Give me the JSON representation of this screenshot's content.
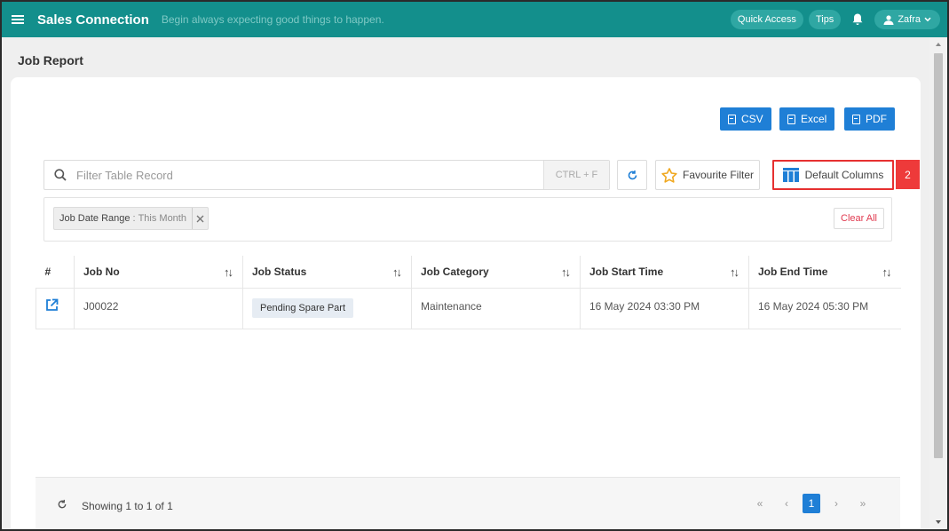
{
  "app": {
    "brand": "Sales Connection",
    "tagline": "Begin always expecting good things to happen.",
    "quick_access": "Quick Access",
    "tips": "Tips",
    "user": "Zafra"
  },
  "page": {
    "title": "Job Report"
  },
  "exports": {
    "csv": "CSV",
    "excel": "Excel",
    "pdf": "PDF"
  },
  "toolbar": {
    "search_placeholder": "Filter Table Record",
    "search_value": "",
    "shortcut": "CTRL + F",
    "favourite_filter": "Favourite Filter",
    "default_columns": "Default Columns",
    "step_badge": "2"
  },
  "filters": {
    "chip_key": "Job Date Range",
    "chip_sep": ":",
    "chip_value": "This Month",
    "clear_all": "Clear All"
  },
  "table": {
    "headers": [
      "#",
      "Job No",
      "Job Status",
      "Job Category",
      "Job Start Time",
      "Job End Time"
    ],
    "rows": [
      {
        "job_no": "J00022",
        "job_status": "Pending Spare Part",
        "job_category": "Maintenance",
        "job_start_time": "16 May 2024 03:30 PM",
        "job_end_time": "16 May 2024 05:30 PM"
      }
    ]
  },
  "footer": {
    "showing": "Showing 1 to 1 of 1",
    "pagination": {
      "first": "«",
      "prev": "‹",
      "current": "1",
      "next": "›",
      "last": "»"
    }
  },
  "colors": {
    "topbar": "#138f8c",
    "primary_button": "#1f7fd6",
    "highlight": "#e63030",
    "clear_all": "#e0394f"
  },
  "icons": [
    "menu-icon",
    "bell-icon",
    "user-icon",
    "chevron-down-icon",
    "file-icon",
    "search-icon",
    "refresh-icon",
    "star-icon",
    "columns-icon",
    "close-icon",
    "sort-icon",
    "external-link-icon"
  ]
}
